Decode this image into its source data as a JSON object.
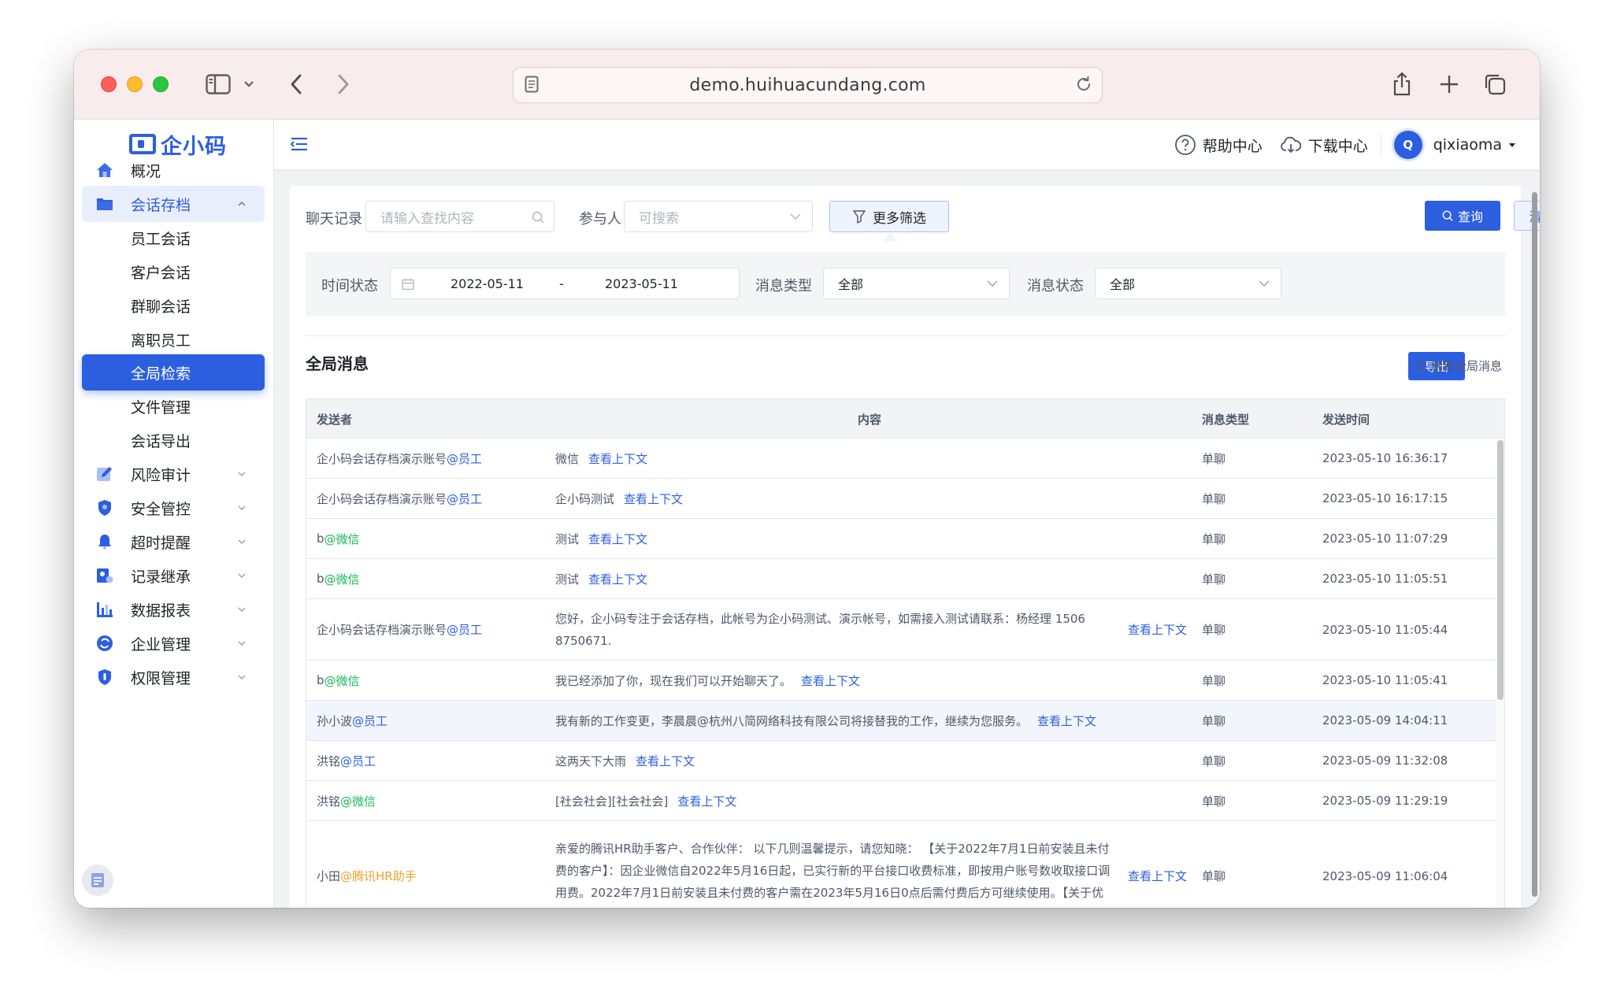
{
  "browser": {
    "url": "demo.huihuacundang.com"
  },
  "brand": {
    "logo_text": "企小码"
  },
  "sidebar": {
    "items": [
      {
        "label": "概况",
        "icon": "home-icon"
      },
      {
        "label": "会话存档",
        "icon": "folder-icon"
      },
      {
        "label": "员工会话"
      },
      {
        "label": "客户会话"
      },
      {
        "label": "群聊会话"
      },
      {
        "label": "离职员工"
      },
      {
        "label": "全局检索"
      },
      {
        "label": "文件管理"
      },
      {
        "label": "会话导出"
      },
      {
        "label": "风险审计",
        "icon": "edit-icon"
      },
      {
        "label": "安全管控",
        "icon": "shield-icon"
      },
      {
        "label": "超时提醒",
        "icon": "bell-icon"
      },
      {
        "label": "记录继承",
        "icon": "inherit-icon"
      },
      {
        "label": "数据报表",
        "icon": "bar-chart-icon"
      },
      {
        "label": "企业管理",
        "icon": "refresh-circle-icon"
      },
      {
        "label": "权限管理",
        "icon": "badge-icon"
      }
    ]
  },
  "header": {
    "help": "帮助中心",
    "download": "下载中心",
    "avatar_letter": "Q",
    "username": "qixiaoma"
  },
  "filters": {
    "chat_label": "聊天记录",
    "chat_placeholder": "请输入查找内容",
    "participant_label": "参与人",
    "participant_placeholder": "可搜索",
    "more_filters": "更多筛选",
    "query": "查询",
    "clear": "清空",
    "time_label": "时间状态",
    "date_start": "2022-05-11",
    "date_sep": "-",
    "date_end": "2023-05-11",
    "msg_type_label": "消息类型",
    "msg_type_value": "全部",
    "msg_status_label": "消息状态",
    "msg_status_value": "全部"
  },
  "section": {
    "title": "全局消息",
    "export": "导出",
    "refresh": "刷新全局消息"
  },
  "table": {
    "columns": [
      "发送者",
      "内容",
      "消息类型",
      "发送时间"
    ],
    "context_link": "查看上下文",
    "rows": [
      {
        "sender": "企小码会话存档演示账号",
        "tag": "@员工",
        "tag_kind": "emp",
        "content": "微信",
        "type": "单聊",
        "time": "2023-05-10 16:36:17"
      },
      {
        "sender": "企小码会话存档演示账号",
        "tag": "@员工",
        "tag_kind": "emp",
        "content": "企小码测试",
        "type": "单聊",
        "time": "2023-05-10 16:17:15"
      },
      {
        "sender": "b",
        "tag": "@微信",
        "tag_kind": "wx",
        "content": "测试",
        "type": "单聊",
        "time": "2023-05-10 11:07:29"
      },
      {
        "sender": "b",
        "tag": "@微信",
        "tag_kind": "wx",
        "content": "测试",
        "type": "单聊",
        "time": "2023-05-10 11:05:51"
      },
      {
        "sender": "企小码会话存档演示账号",
        "tag": "@员工",
        "tag_kind": "emp",
        "content": "您好，企小码专注于会话存档，此帐号为企小码测试、演示帐号，如需接入测试请联系：杨经理 1506 8750671.",
        "type": "单聊",
        "time": "2023-05-10 11:05:44"
      },
      {
        "sender": "b",
        "tag": "@微信",
        "tag_kind": "wx",
        "content": "我已经添加了你，现在我们可以开始聊天了。",
        "type": "单聊",
        "time": "2023-05-10 11:05:41"
      },
      {
        "sender": "孙小波",
        "tag": "@员工",
        "tag_kind": "emp",
        "content": "我有新的工作变更，李晨晨@杭州八简网络科技有限公司将接替我的工作，继续为您服务。",
        "type": "单聊",
        "time": "2023-05-09 14:04:11"
      },
      {
        "sender": "洪铭",
        "tag": "@员工",
        "tag_kind": "emp",
        "content": "这两天下大雨",
        "type": "单聊",
        "time": "2023-05-09 11:32:08"
      },
      {
        "sender": "洪铭",
        "tag": "@微信",
        "tag_kind": "wx",
        "content": "[社会社会][社会社会]",
        "type": "单聊",
        "time": "2023-05-09 11:29:19"
      },
      {
        "sender": "小田",
        "tag": "@腾讯HR助手",
        "tag_kind": "hr",
        "content": "亲爱的腾讯HR助手客户、合作伙伴： 以下几则温馨提示，请您知晓： 【关于2022年7月1日前安装且未付费的客户】：因企业微信自2022年5月16日起，已实行新的平台接口收费标准，即按用户账号数收取接口调用费。2022年7月1日前安装且未付费的客户需在2023年5月16日0点后需付费后方可继续使用。【关于优惠】：2023年5月10日-2023年6月10日期间新老客户联系客户下单可享折扣优惠。更多",
        "type": "单聊",
        "time": "2023-05-09 11:06:04"
      }
    ]
  },
  "colors": {
    "primary": "#2c5fe0",
    "wechat_green": "#19b95b",
    "hr_orange": "#f2a12b"
  }
}
